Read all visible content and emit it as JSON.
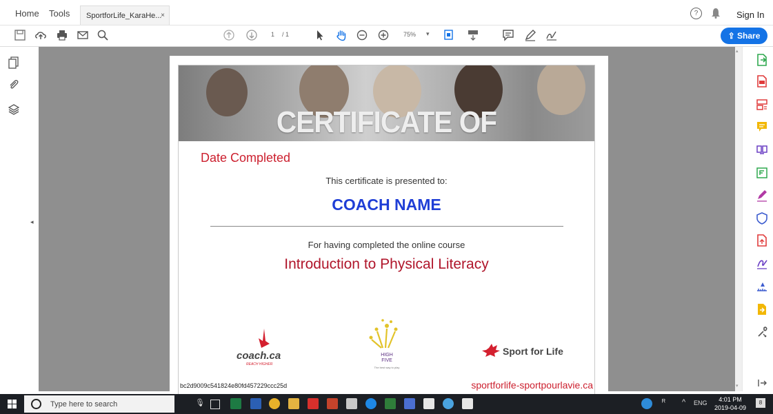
{
  "tabs": {
    "home": "Home",
    "tools": "Tools",
    "document": "SportforLife_KaraHe...",
    "close": "×"
  },
  "header": {
    "sign_in": "Sign In"
  },
  "toolbar": {
    "page_current": "1",
    "page_total": "/ 1",
    "zoom": "75%",
    "share_label": "Share"
  },
  "certificate": {
    "banner_title": "CERTIFICATE OF ACHIEVEMENT",
    "date_completed": "Date Completed",
    "presented_to": "This certificate is presented to:",
    "coach_name": "COACH NAME",
    "completed_course": "For having completed the online course",
    "course_name": "Introduction to Physical Literacy",
    "hash": "bc2d9009c541824e80fd457229ccc25d",
    "website": "sportforlife-sportpourlavie.ca",
    "coach_logo_text": "coach.ca",
    "coach_logo_tagline": "REACH HIGHER",
    "highfive_text": "HIGH FIVE",
    "highfive_tagline": "The best way to play",
    "sfl_text": "Sport for Life"
  },
  "taskbar": {
    "search_placeholder": "Type here to search",
    "language": "ENG",
    "time": "4:01 PM",
    "date": "2019-04-09",
    "notifications": "8"
  },
  "colors": {
    "accent": "#1473e6",
    "certificate_red": "#cc1f2e",
    "coach_name_blue": "#1f3ed6",
    "course_red": "#b0162b",
    "taskbar": "#1c1f24",
    "doc_background": "#8f8f8f"
  },
  "icons": {
    "toolbar": [
      "save-icon",
      "upload-icon",
      "print-icon",
      "email-icon",
      "search-zoom-icon",
      "page-up-icon",
      "page-down-icon",
      "select-arrow-icon",
      "hand-icon",
      "zoom-out-icon",
      "zoom-in-icon",
      "fit-page-icon",
      "scroll-mode-icon",
      "comment-icon",
      "highlight-pen-icon",
      "sign-icon"
    ],
    "left_rail": [
      "pages-icon",
      "attachment-icon",
      "layers-icon"
    ],
    "right_rail": [
      "export-pdf-icon",
      "create-pdf-icon",
      "organize-pages-icon",
      "comment-tool-icon",
      "combine-files-icon",
      "edit-pdf-icon",
      "fill-sign-icon",
      "protect-icon",
      "send-for-review-icon",
      "certificates-icon",
      "measure-icon",
      "send-file-icon",
      "more-tools-icon",
      "expand-panel-icon"
    ]
  }
}
